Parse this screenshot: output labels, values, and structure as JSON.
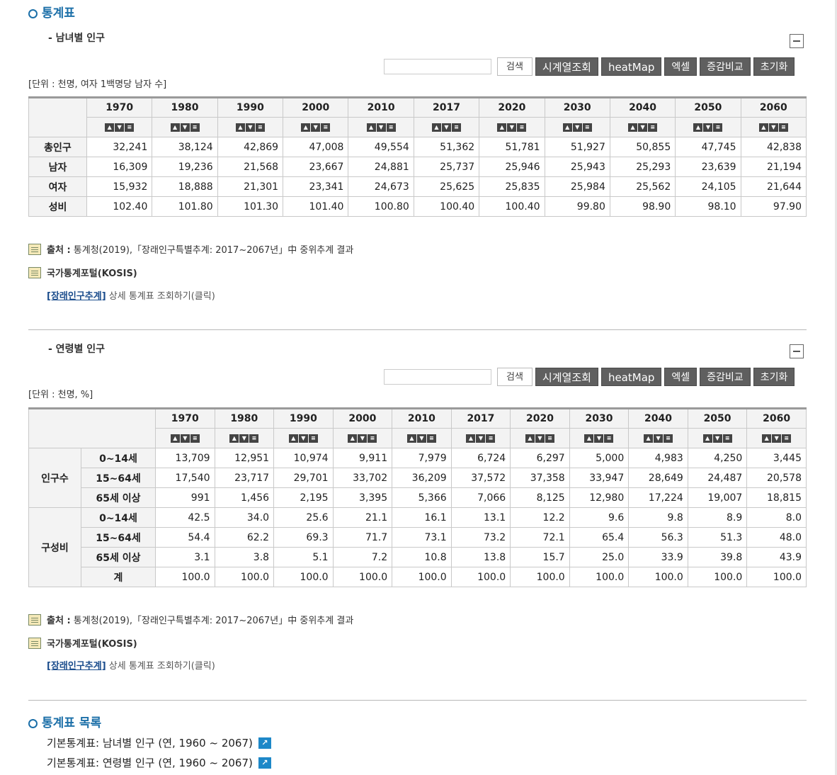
{
  "page": {
    "section_title": "통계표",
    "list_title": "통계표 목록"
  },
  "toolbar": {
    "search_placeholder": "",
    "search_label": "검색",
    "timeseries_label": "시계열조회",
    "heatmap_label": "heatMap",
    "excel_label": "엑셀",
    "compare_label": "증감비교",
    "reset_label": "초기화"
  },
  "table1": {
    "title": "- 남녀별 인구",
    "unit": "[단위 : 천명, 여자 1백명당 남자 수]",
    "years": [
      "1970",
      "1980",
      "1990",
      "2000",
      "2010",
      "2017",
      "2020",
      "2030",
      "2040",
      "2050",
      "2060"
    ],
    "rows": [
      {
        "label": "총인구",
        "values": [
          "32,241",
          "38,124",
          "42,869",
          "47,008",
          "49,554",
          "51,362",
          "51,781",
          "51,927",
          "50,855",
          "47,745",
          "42,838"
        ]
      },
      {
        "label": "남자",
        "values": [
          "16,309",
          "19,236",
          "21,568",
          "23,667",
          "24,881",
          "25,737",
          "25,946",
          "25,943",
          "25,293",
          "23,639",
          "21,194"
        ]
      },
      {
        "label": "여자",
        "values": [
          "15,932",
          "18,888",
          "21,301",
          "23,341",
          "24,673",
          "25,625",
          "25,835",
          "25,984",
          "25,562",
          "24,105",
          "21,644"
        ]
      },
      {
        "label": "성비",
        "values": [
          "102.40",
          "101.80",
          "101.30",
          "101.40",
          "100.80",
          "100.40",
          "100.40",
          "99.80",
          "98.90",
          "98.10",
          "97.90"
        ]
      }
    ],
    "source_label": "출처 :",
    "source_text": "통계청(2019),「장래인구특별추계: 2017~2067년」中 중위추계 결과",
    "kosis_label": "국가통계포털(KOSIS)",
    "link_text": "[장래인구추계]",
    "link_desc": "상세 통계표 조회하기(클릭)"
  },
  "table2": {
    "title": "- 연령별 인구",
    "unit": "[단위 : 천명, %]",
    "years": [
      "1970",
      "1980",
      "1990",
      "2000",
      "2010",
      "2017",
      "2020",
      "2030",
      "2040",
      "2050",
      "2060"
    ],
    "groups": [
      {
        "label": "인구수",
        "rows": [
          {
            "label": "0~14세",
            "values": [
              "13,709",
              "12,951",
              "10,974",
              "9,911",
              "7,979",
              "6,724",
              "6,297",
              "5,000",
              "4,983",
              "4,250",
              "3,445"
            ]
          },
          {
            "label": "15~64세",
            "values": [
              "17,540",
              "23,717",
              "29,701",
              "33,702",
              "36,209",
              "37,572",
              "37,358",
              "33,947",
              "28,649",
              "24,487",
              "20,578"
            ]
          },
          {
            "label": "65세 이상",
            "values": [
              "991",
              "1,456",
              "2,195",
              "3,395",
              "5,366",
              "7,066",
              "8,125",
              "12,980",
              "17,224",
              "19,007",
              "18,815"
            ]
          }
        ]
      },
      {
        "label": "구성비",
        "rows": [
          {
            "label": "0~14세",
            "values": [
              "42.5",
              "34.0",
              "25.6",
              "21.1",
              "16.1",
              "13.1",
              "12.2",
              "9.6",
              "9.8",
              "8.9",
              "8.0"
            ]
          },
          {
            "label": "15~64세",
            "values": [
              "54.4",
              "62.2",
              "69.3",
              "71.7",
              "73.1",
              "73.2",
              "72.1",
              "65.4",
              "56.3",
              "51.3",
              "48.0"
            ]
          },
          {
            "label": "65세 이상",
            "values": [
              "3.1",
              "3.8",
              "5.1",
              "7.2",
              "10.8",
              "13.8",
              "15.7",
              "25.0",
              "33.9",
              "39.8",
              "43.9"
            ]
          },
          {
            "label": "계",
            "values": [
              "100.0",
              "100.0",
              "100.0",
              "100.0",
              "100.0",
              "100.0",
              "100.0",
              "100.0",
              "100.0",
              "100.0",
              "100.0"
            ]
          }
        ]
      }
    ],
    "source_label": "출처 :",
    "source_text": "통계청(2019),「장래인구특별추계: 2017~2067년」中 중위추계 결과",
    "kosis_label": "국가통계포털(KOSIS)",
    "link_text": "[장래인구추계]",
    "link_desc": "상세 통계표 조회하기(클릭)"
  },
  "stat_list": [
    {
      "label": "기본통계표: 남녀별 인구 (연, 1960 ~ 2067)"
    },
    {
      "label": "기본통계표: 연령별 인구 (연, 1960 ~ 2067)"
    }
  ],
  "icons": {
    "sort": [
      "sort-up-icon",
      "sort-down-icon",
      "sort-menu-icon"
    ],
    "external": "external-link-icon",
    "note": "document-note-icon",
    "collapse": "collapse-minus-icon"
  },
  "colors": {
    "title_blue": "#1b6fa8",
    "button_dark": "#5f5f5f",
    "link_blue": "#1a4c8c",
    "external_icon": "#1e88c8"
  }
}
